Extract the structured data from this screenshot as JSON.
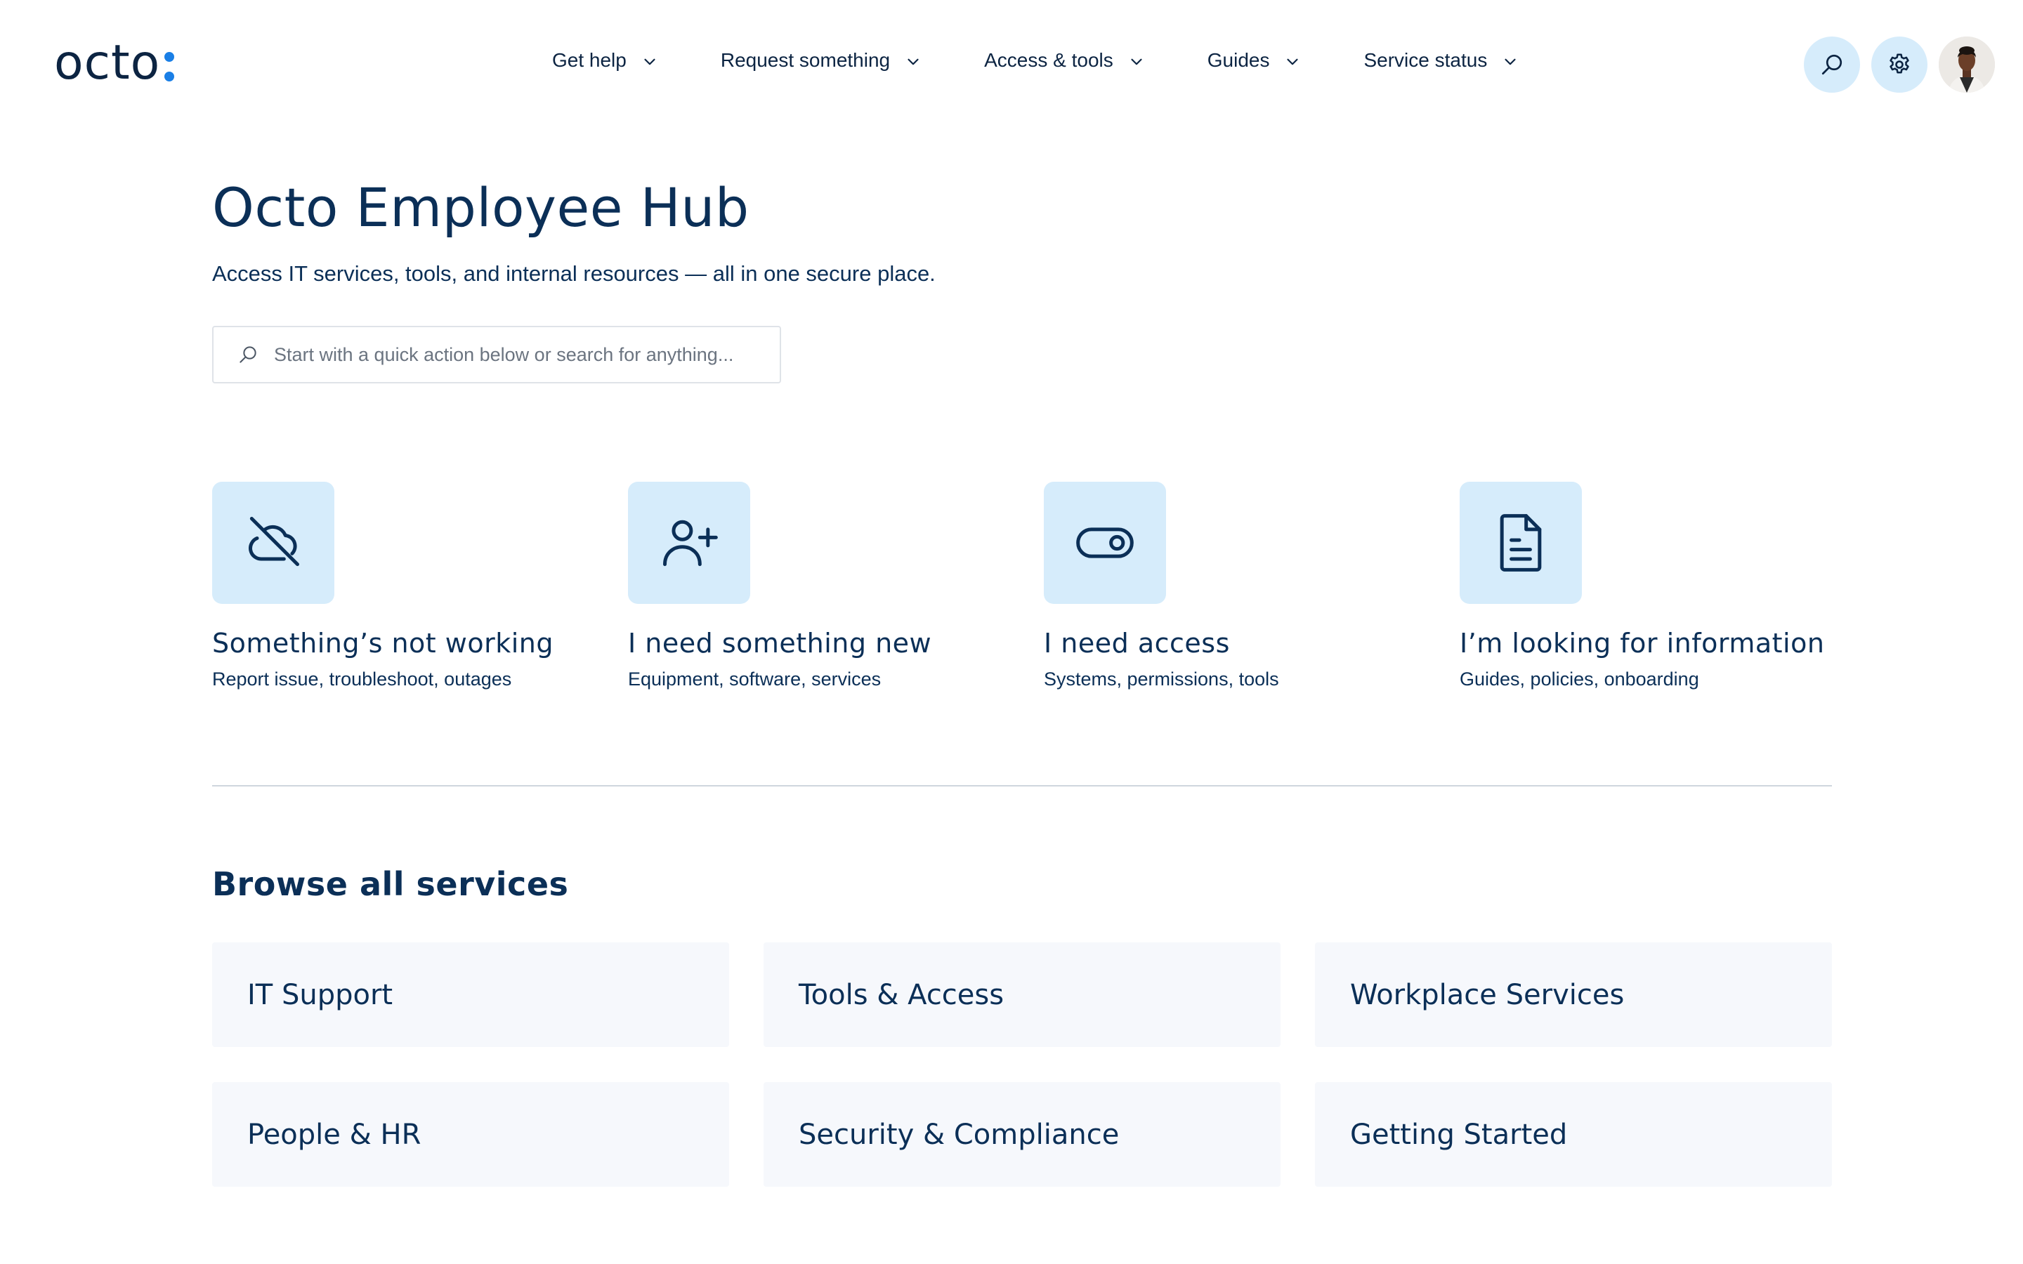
{
  "brand": {
    "logo_text": "octo",
    "accent": "#1a7fe6"
  },
  "nav": {
    "items": [
      {
        "label": "Get help"
      },
      {
        "label": "Request something"
      },
      {
        "label": "Access & tools"
      },
      {
        "label": "Guides"
      },
      {
        "label": "Service status"
      }
    ]
  },
  "header_actions": {
    "search_icon": "search-icon",
    "settings_icon": "gear-icon",
    "avatar": "user-avatar"
  },
  "hero": {
    "title": "Octo Employee Hub",
    "subtitle": "Access IT services, tools, and internal resources — all in one secure place.",
    "search_placeholder": "Start with a quick action below or search for anything..."
  },
  "quick_actions": [
    {
      "icon": "cloud-off-icon",
      "title": "Something’s not working",
      "description": "Report issue, troubleshoot, outages"
    },
    {
      "icon": "user-plus-icon",
      "title": "I need something new",
      "description": "Equipment, software, services"
    },
    {
      "icon": "toggle-icon",
      "title": "I need access",
      "description": "Systems, permissions, tools"
    },
    {
      "icon": "document-icon",
      "title": "I’m looking for information",
      "description": "Guides, policies, onboarding"
    }
  ],
  "browse": {
    "title": "Browse all services",
    "services": [
      {
        "label": "IT Support"
      },
      {
        "label": "Tools & Access"
      },
      {
        "label": "Workplace Services"
      },
      {
        "label": "People & HR"
      },
      {
        "label": "Security & Compliance"
      },
      {
        "label": "Getting Started"
      }
    ]
  },
  "colors": {
    "primary_text": "#0b2f57",
    "tile_bg": "#d6ecfb",
    "card_bg": "#f6f8fc"
  }
}
